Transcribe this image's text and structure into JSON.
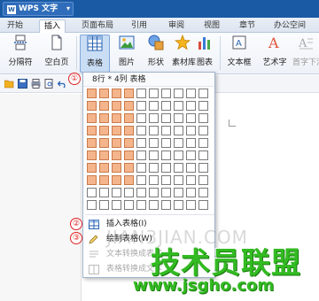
{
  "app": {
    "name": "WPS 文字",
    "logo_letter": "W",
    "caret": "▾"
  },
  "tabs": [
    {
      "label": "开始",
      "active": false
    },
    {
      "label": "插入",
      "active": true
    },
    {
      "label": "页面布局",
      "active": false
    },
    {
      "label": "引用",
      "active": false
    },
    {
      "label": "审阅",
      "active": false
    },
    {
      "label": "视图",
      "active": false
    },
    {
      "label": "章节",
      "active": false
    },
    {
      "label": "办公空间",
      "active": false
    }
  ],
  "ribbon": {
    "page_break": "分隔符",
    "blank_page": "空白页",
    "table": "表格",
    "picture": "图片",
    "shape": "形状",
    "material": "素材库",
    "chart": "图表",
    "textbox": "文本框",
    "wordart": "艺术字",
    "dropcap": "首字下沉"
  },
  "table_menu": {
    "header": "8行 * 4列 表格",
    "grid_rows": 10,
    "grid_cols": 10,
    "selected_rows": 8,
    "selected_cols": 4,
    "items": [
      {
        "label": "插入表格(I)",
        "enabled": true
      },
      {
        "label": "绘制表格(W)",
        "enabled": true
      },
      {
        "label": "文本转换成表格",
        "enabled": false
      },
      {
        "label": "表格转换成文本",
        "enabled": false
      }
    ]
  },
  "annotations": {
    "one": "①",
    "two": "②",
    "three": "③"
  },
  "watermarks": {
    "site_faint": "JIAN3JIAN.COM",
    "brand": "技术员联盟",
    "url": "www.jsgho.com"
  },
  "colors": {
    "titlebar": "#1a5aa4",
    "selection": "#f5b58c",
    "annotation": "#dd2222",
    "brand_green": "#33bb22"
  }
}
